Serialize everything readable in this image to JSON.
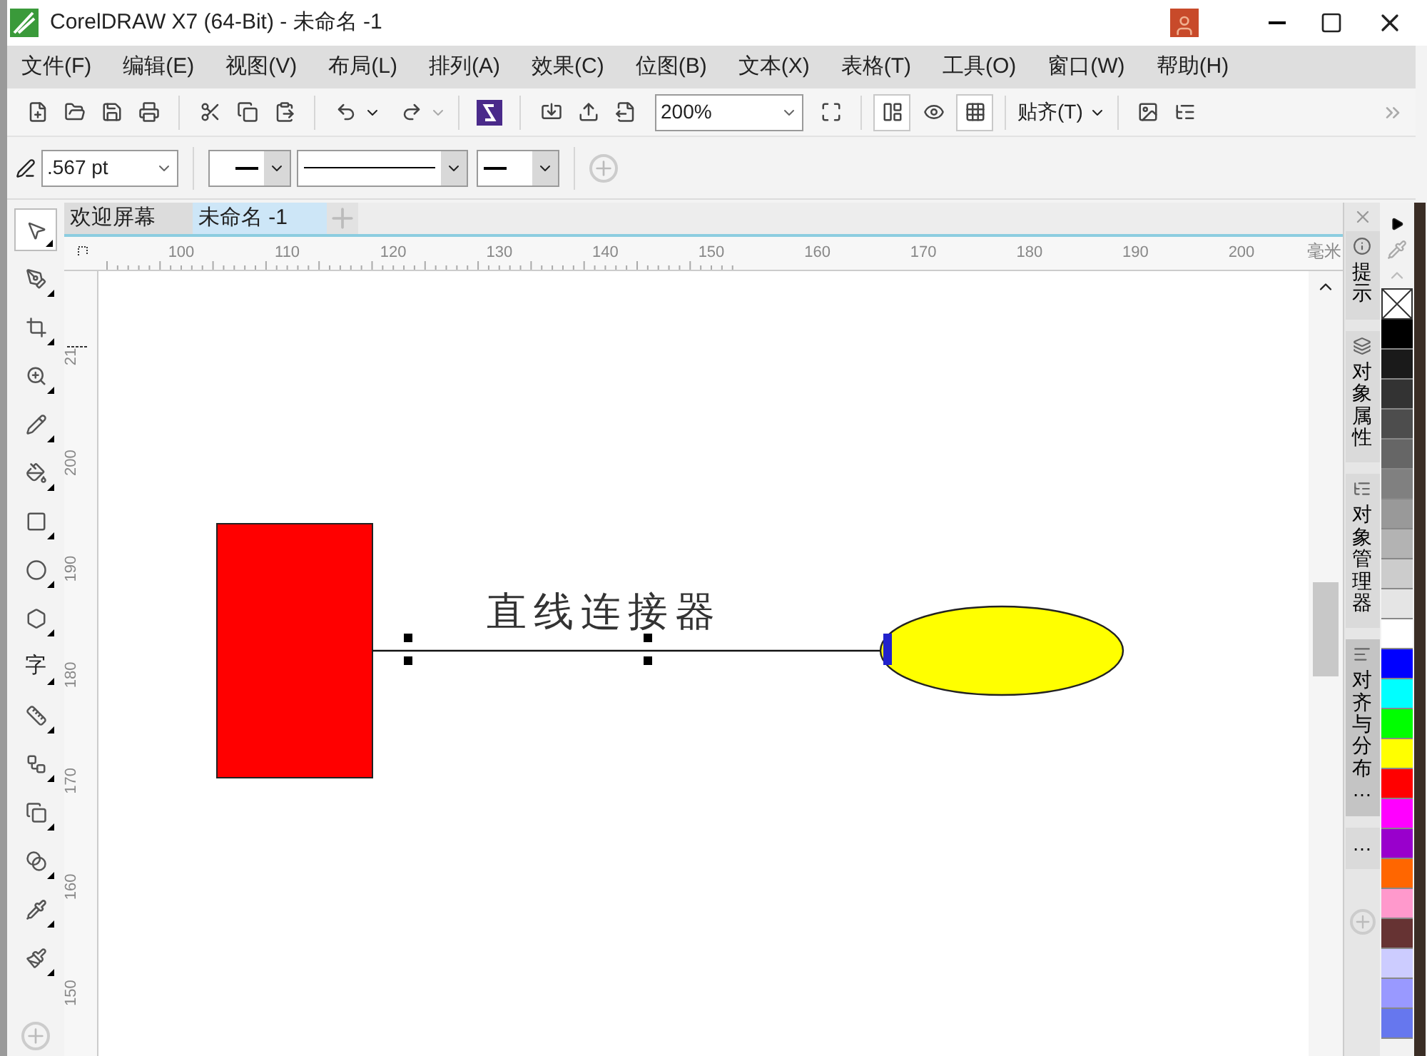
{
  "window": {
    "title": "CorelDRAW X7 (64-Bit) - 未命名 -1"
  },
  "menu": [
    "文件(F)",
    "编辑(E)",
    "视图(V)",
    "布局(L)",
    "排列(A)",
    "效果(C)",
    "位图(B)",
    "文本(X)",
    "表格(T)",
    "工具(O)",
    "窗口(W)",
    "帮助(H)"
  ],
  "toolbar": {
    "zoom": "200%",
    "snap": "贴齐(T)"
  },
  "property_bar": {
    "outline_width": ".567 pt"
  },
  "toolbox": [
    {
      "kind": "pick",
      "selected": true
    },
    {
      "kind": "shape",
      "selected": false
    },
    {
      "kind": "crop",
      "selected": false
    },
    {
      "kind": "zoom",
      "selected": false
    },
    {
      "kind": "freehand",
      "selected": false
    },
    {
      "kind": "smartfill",
      "selected": false
    },
    {
      "kind": "rectangle",
      "selected": false
    },
    {
      "kind": "ellipse",
      "selected": false
    },
    {
      "kind": "polygon",
      "selected": false
    },
    {
      "kind": "text",
      "label": "字",
      "selected": false
    },
    {
      "kind": "dimension",
      "selected": false
    },
    {
      "kind": "connector",
      "selected": false
    },
    {
      "kind": "shadow",
      "selected": false
    },
    {
      "kind": "transparency",
      "selected": false
    },
    {
      "kind": "eyedropper",
      "selected": false
    },
    {
      "kind": "fill",
      "selected": false
    }
  ],
  "tabs": [
    {
      "label": "欢迎屏幕",
      "selected": false
    },
    {
      "label": "未命名 -1",
      "selected": true
    }
  ],
  "ruler": {
    "horizontal": [
      "100",
      "110",
      "120",
      "130",
      "140",
      "150",
      "160",
      "170",
      "180",
      "190",
      "200"
    ],
    "unit": "毫米",
    "vertical": [
      "21",
      "200",
      "190",
      "180",
      "170",
      "160",
      "150"
    ]
  },
  "canvas": {
    "text": "直线连接器"
  },
  "dockers": [
    {
      "label": "提示",
      "selected": false
    },
    {
      "label": "对象属性",
      "selected": false
    },
    {
      "label": "对象管理器",
      "selected": false
    },
    {
      "label": "对齐与分布…",
      "selected": true
    },
    {
      "label": "…",
      "selected": false
    }
  ],
  "palette": [
    {
      "color": "#000000"
    },
    {
      "color": "#1a1a1a"
    },
    {
      "color": "#333333"
    },
    {
      "color": "#4d4d4d"
    },
    {
      "color": "#666666"
    },
    {
      "color": "#808080"
    },
    {
      "color": "#999999"
    },
    {
      "color": "#b3b3b3"
    },
    {
      "color": "#cccccc"
    },
    {
      "color": "#e5e5e5"
    },
    {
      "color": "#ffffff"
    },
    {
      "color": "#0000ff"
    },
    {
      "color": "#00ffff"
    },
    {
      "color": "#00ff00"
    },
    {
      "color": "#ffff00"
    },
    {
      "color": "#ff0000"
    },
    {
      "color": "#ff00ff"
    },
    {
      "color": "#9900cc"
    },
    {
      "color": "#ff6600"
    },
    {
      "color": "#ff99cc"
    },
    {
      "color": "#663333"
    },
    {
      "color": "#ccccff"
    },
    {
      "color": "#9999ff"
    },
    {
      "color": "#6677ee"
    }
  ]
}
